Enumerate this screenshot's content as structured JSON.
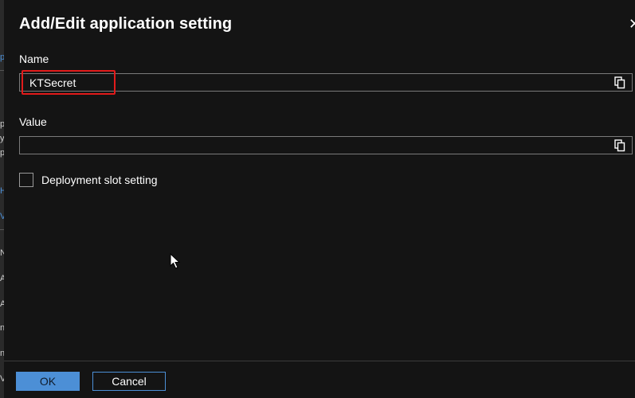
{
  "left_fragments": [
    "p",
    "y",
    "p",
    "H",
    "V",
    "N",
    "A",
    "A",
    "n",
    "n",
    "V"
  ],
  "dialog": {
    "title": "Add/Edit application setting",
    "name_label": "Name",
    "name_value": "KTSecret",
    "value_label": "Value",
    "value_value": "",
    "checkbox_label": "Deployment slot setting",
    "checkbox_checked": false
  },
  "footer": {
    "ok_label": "OK",
    "cancel_label": "Cancel"
  },
  "colors": {
    "background": "#141414",
    "accent": "#4c8fd6",
    "highlight": "#e21b1b"
  },
  "icons": {
    "copy": "copy-icon",
    "close": "close-icon",
    "cursor": "mouse-cursor-icon"
  }
}
